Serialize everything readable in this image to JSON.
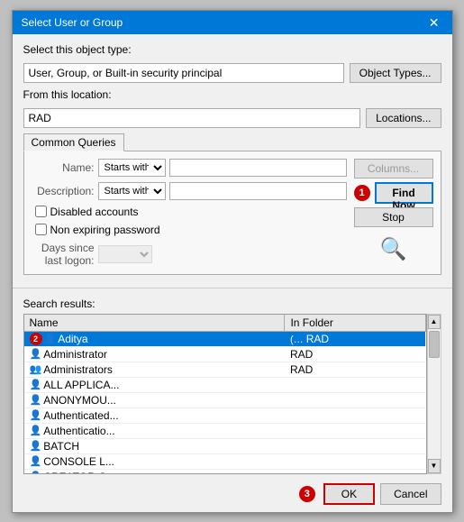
{
  "dialog": {
    "title": "Select User or Group",
    "close_label": "✕"
  },
  "object_type_section": {
    "label": "Select this object type:",
    "value": "User, Group, or Built-in security principal",
    "button_label": "Object Types..."
  },
  "location_section": {
    "label": "From this location:",
    "value": "RAD",
    "button_label": "Locations..."
  },
  "common_queries": {
    "tab_label": "Common Queries",
    "name_label": "Name:",
    "name_select_option": "Starts with",
    "description_label": "Description:",
    "desc_select_option": "Starts with",
    "disabled_accounts_label": "Disabled accounts",
    "non_expiring_label": "Non expiring password",
    "days_label": "Days since last logon:",
    "columns_button": "Columns...",
    "find_now_button": "Find Now",
    "stop_button": "Stop"
  },
  "search_results": {
    "label": "Search results:",
    "columns": [
      {
        "id": "name",
        "header": "Name"
      },
      {
        "id": "folder",
        "header": "In Folder"
      }
    ],
    "rows": [
      {
        "name": "Aditya",
        "folder_prefix": "(…",
        "folder": "RAD",
        "selected": true,
        "icon": "👤"
      },
      {
        "name": "Administrator",
        "folder": "RAD",
        "selected": false,
        "icon": "👤"
      },
      {
        "name": "Administrators",
        "folder": "RAD",
        "selected": false,
        "icon": "👥"
      },
      {
        "name": "ALL APPLICA...",
        "folder": "",
        "selected": false,
        "icon": "👤"
      },
      {
        "name": "ANONYMOU...",
        "folder": "",
        "selected": false,
        "icon": "👤"
      },
      {
        "name": "Authenticated...",
        "folder": "",
        "selected": false,
        "icon": "👤"
      },
      {
        "name": "Authenticatio...",
        "folder": "",
        "selected": false,
        "icon": "👤"
      },
      {
        "name": "BATCH",
        "folder": "",
        "selected": false,
        "icon": "👤"
      },
      {
        "name": "CONSOLE L...",
        "folder": "",
        "selected": false,
        "icon": "👤"
      },
      {
        "name": "CREATOR G...",
        "folder": "",
        "selected": false,
        "icon": "👤"
      }
    ]
  },
  "buttons": {
    "ok_label": "OK",
    "cancel_label": "Cancel"
  },
  "badges": {
    "find_now_badge": "1",
    "row_badge": "2",
    "ok_badge": "3"
  }
}
